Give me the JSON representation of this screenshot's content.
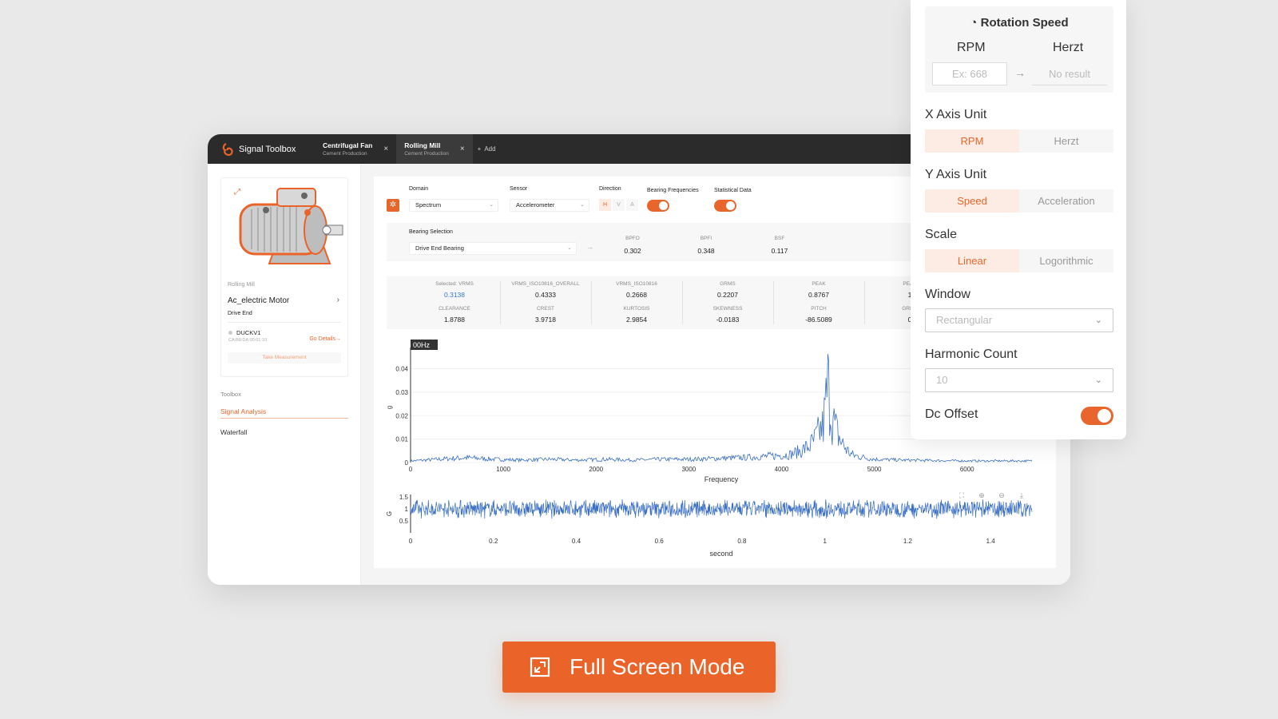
{
  "app": {
    "brand": "Signal Toolbox",
    "tabs": [
      {
        "title": "Centrifugal Fan",
        "subtitle": "Cement Production",
        "close": "×"
      },
      {
        "title": "Rolling Mill",
        "subtitle": "Cement Production",
        "close": "×"
      }
    ],
    "add_label": "Add",
    "add_icon": "+"
  },
  "sidebar": {
    "site": "Rolling Mill",
    "machine_name": "Ac_electric Motor",
    "machine_sub": "Drive End",
    "sensor_name": "DUCKV1",
    "sensor_mac": "CA:B8:DA:00:01:10",
    "go_details": "Go Details→",
    "take_measurement": "Take Measurement",
    "toolbox_label": "Toolbox",
    "nav": [
      "Signal Analysis",
      "Waterfall"
    ]
  },
  "controls": {
    "domain_label": "Domain",
    "domain_value": "Spectrum",
    "sensor_label": "Sensor",
    "sensor_value": "Accelerometer",
    "direction_label": "Direction",
    "directions": [
      "H",
      "V",
      "A"
    ],
    "bearing_freq_label": "Bearing Frequencies",
    "statistical_label": "Statistical Data",
    "bearing_selection_label": "Bearing Selection",
    "bearing_selection_value": "Drive End Bearing"
  },
  "bearing_freqs": [
    {
      "label": "BPFO",
      "value": "0.302"
    },
    {
      "label": "BPFI",
      "value": "0.348"
    },
    {
      "label": "BSF",
      "value": "0.117"
    }
  ],
  "stats": {
    "row1": [
      {
        "label": "Selected: VRMS",
        "value": "0.3138"
      },
      {
        "label": "VRMS_ISO10816_OVERALL",
        "value": "0.4333"
      },
      {
        "label": "VRMS_ISO10816",
        "value": "0.2668"
      },
      {
        "label": "GRMS",
        "value": "0.2207"
      },
      {
        "label": "PEAK",
        "value": "0.8767"
      },
      {
        "label": "PEAK",
        "value": "1"
      }
    ],
    "row2": [
      {
        "label": "CLEARANCE",
        "value": "1.8788"
      },
      {
        "label": "CREST",
        "value": "3.9718"
      },
      {
        "label": "KURTOSIS",
        "value": "2.9854"
      },
      {
        "label": "SKEWNESS",
        "value": "-0.0183"
      },
      {
        "label": "PITCH",
        "value": "-86.5089"
      },
      {
        "label": "GRMS",
        "value": "0"
      }
    ]
  },
  "spectrum_tag": "00Hz",
  "chart_data": [
    {
      "type": "line",
      "title": "",
      "xlabel": "Frequency",
      "ylabel": "g",
      "xlim": [
        0,
        6700
      ],
      "ylim": [
        0,
        0.047
      ],
      "xticks": [
        0,
        1000,
        2000,
        3000,
        4000,
        5000,
        6000
      ],
      "yticks": [
        0,
        0.01,
        0.02,
        0.03,
        0.04
      ],
      "ytick_labels": [
        "0",
        "0.01",
        "0.02",
        "0.03",
        "0.04"
      ],
      "series": [
        {
          "color": "#3a6fc4",
          "x": [
            0,
            300,
            600,
            900,
            1200,
            1500,
            1800,
            2100,
            2400,
            2700,
            3000,
            3300,
            3600,
            3900,
            4100,
            4200,
            4300,
            4350,
            4400,
            4450,
            4500,
            4550,
            4600,
            4650,
            4700,
            4750,
            4800,
            4900,
            5000,
            5300,
            5700,
            6000,
            6300,
            6700
          ],
          "y": [
            0.001,
            0.002,
            0.003,
            0.002,
            0.0015,
            0.002,
            0.0015,
            0.002,
            0.0015,
            0.002,
            0.002,
            0.0025,
            0.003,
            0.004,
            0.005,
            0.007,
            0.01,
            0.013,
            0.018,
            0.022,
            0.047,
            0.026,
            0.018,
            0.012,
            0.008,
            0.005,
            0.004,
            0.003,
            0.002,
            0.0015,
            0.0012,
            0.001,
            0.001,
            0.001
          ]
        }
      ]
    },
    {
      "type": "line",
      "title": "",
      "xlabel": "second",
      "ylabel": "G",
      "xlim": [
        0,
        1.5
      ],
      "ylim": [
        0,
        1.6
      ],
      "xticks": [
        0,
        0.2,
        0.4,
        0.6,
        0.8,
        1,
        1.2,
        1.4
      ],
      "yticks": [
        0.5,
        1,
        1.5
      ],
      "series": [
        {
          "color": "#3a6fc4",
          "center": 1.0,
          "amplitude": 0.35,
          "x": [
            0,
            0.25,
            0.5,
            0.75,
            1.0,
            1.25,
            1.5
          ],
          "y": [
            1.0,
            1.0,
            1.0,
            1.0,
            1.0,
            1.0,
            1.0
          ]
        }
      ]
    }
  ],
  "settings": {
    "rotation_title": "Rotation Speed",
    "rpm_label": "RPM",
    "herzt_label": "Herzt",
    "rpm_placeholder": "Ex: 668",
    "result_placeholder": "No result",
    "arrow": "→",
    "x_axis_unit_title": "X Axis Unit",
    "x_axis_options": [
      "RPM",
      "Herzt"
    ],
    "y_axis_unit_title": "Y Axis Unit",
    "y_axis_options": [
      "Speed",
      "Acceleration"
    ],
    "scale_title": "Scale",
    "scale_options": [
      "Linear",
      "Logorithmic"
    ],
    "window_title": "Window",
    "window_value": "Rectangular",
    "harmonic_title": "Harmonic Count",
    "harmonic_value": "10",
    "dc_offset_title": "Dc Offset"
  },
  "fullscreen_label": "Full Screen Mode",
  "colors": {
    "accent": "#ea6329",
    "signal": "#3a6fc4",
    "dark": "#2b2b2b"
  }
}
